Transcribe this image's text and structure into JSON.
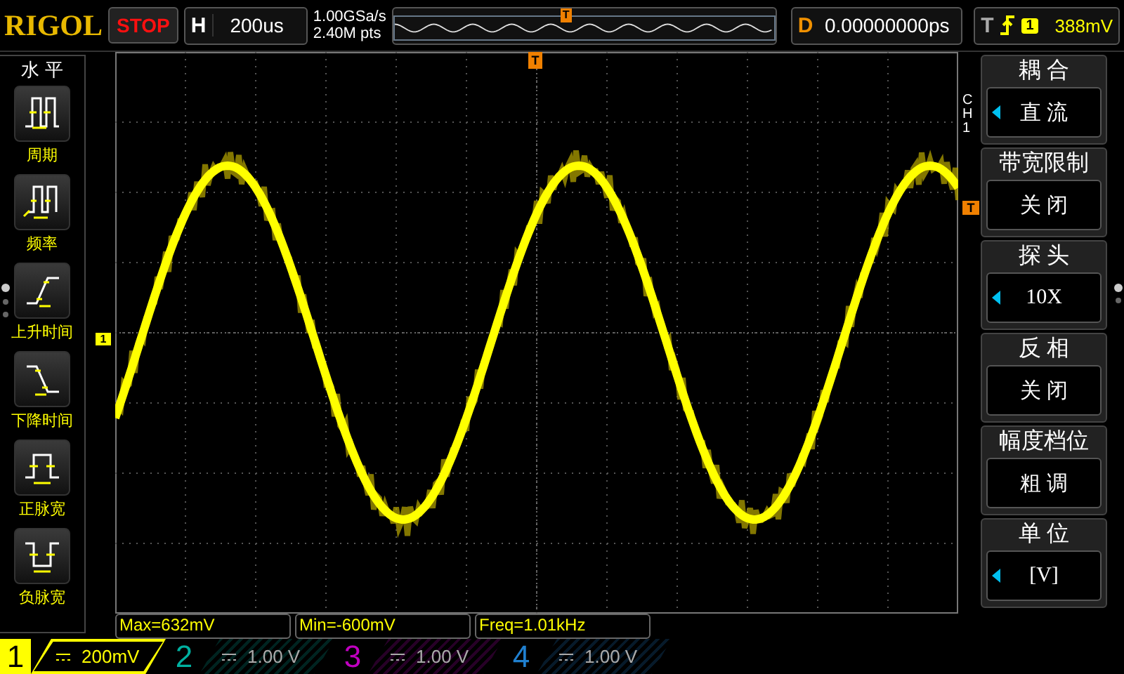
{
  "logo": "RIGOL",
  "run_state": {
    "label": "STOP",
    "kind": "stop"
  },
  "horizontal": {
    "label": "H",
    "value": "200us"
  },
  "sampling": {
    "rate": "1.00GSa/s",
    "depth": "2.40M pts"
  },
  "overview": {
    "trigger_marker": "T"
  },
  "delay": {
    "label": "D",
    "value": "0.00000000ps"
  },
  "trigger": {
    "label": "T",
    "source": "1",
    "level_text": "388mV"
  },
  "left_menu": {
    "title": "水 平",
    "items": [
      {
        "label": "周期",
        "kind": "period"
      },
      {
        "label": "频率",
        "kind": "frequency"
      },
      {
        "label": "上升时间",
        "kind": "rise"
      },
      {
        "label": "下降时间",
        "kind": "fall"
      },
      {
        "label": "正脉宽",
        "kind": "pos_width"
      },
      {
        "label": "负脉宽",
        "kind": "neg_width"
      }
    ]
  },
  "markers": {
    "trigger_position": "T",
    "channel": "1",
    "trigger_level": "T"
  },
  "right_menu": {
    "channel": "CH1",
    "items": [
      {
        "title": "耦 合",
        "value": "直 流",
        "arrow": true
      },
      {
        "title": "带宽限制",
        "value": "关 闭",
        "arrow": false
      },
      {
        "title": "探 头",
        "value": "10X",
        "arrow": true
      },
      {
        "title": "反 相",
        "value": "关 闭",
        "arrow": false
      },
      {
        "title": "幅度档位",
        "value": "粗 调",
        "arrow": false
      },
      {
        "title": "单 位",
        "value": "[V]",
        "arrow": true
      }
    ]
  },
  "measurements": [
    "Max=632mV",
    "Min=-600mV",
    "Freq=1.01kHz"
  ],
  "channels": [
    {
      "number": "1",
      "scale": "200mV",
      "selected": true,
      "color": "#ffff00"
    },
    {
      "number": "2",
      "scale": "1.00 V",
      "selected": false,
      "color": "#00b0a0"
    },
    {
      "number": "3",
      "scale": "1.00 V",
      "selected": false,
      "color": "#c000c0"
    },
    {
      "number": "4",
      "scale": "1.00 V",
      "selected": false,
      "color": "#2080d0"
    }
  ]
}
